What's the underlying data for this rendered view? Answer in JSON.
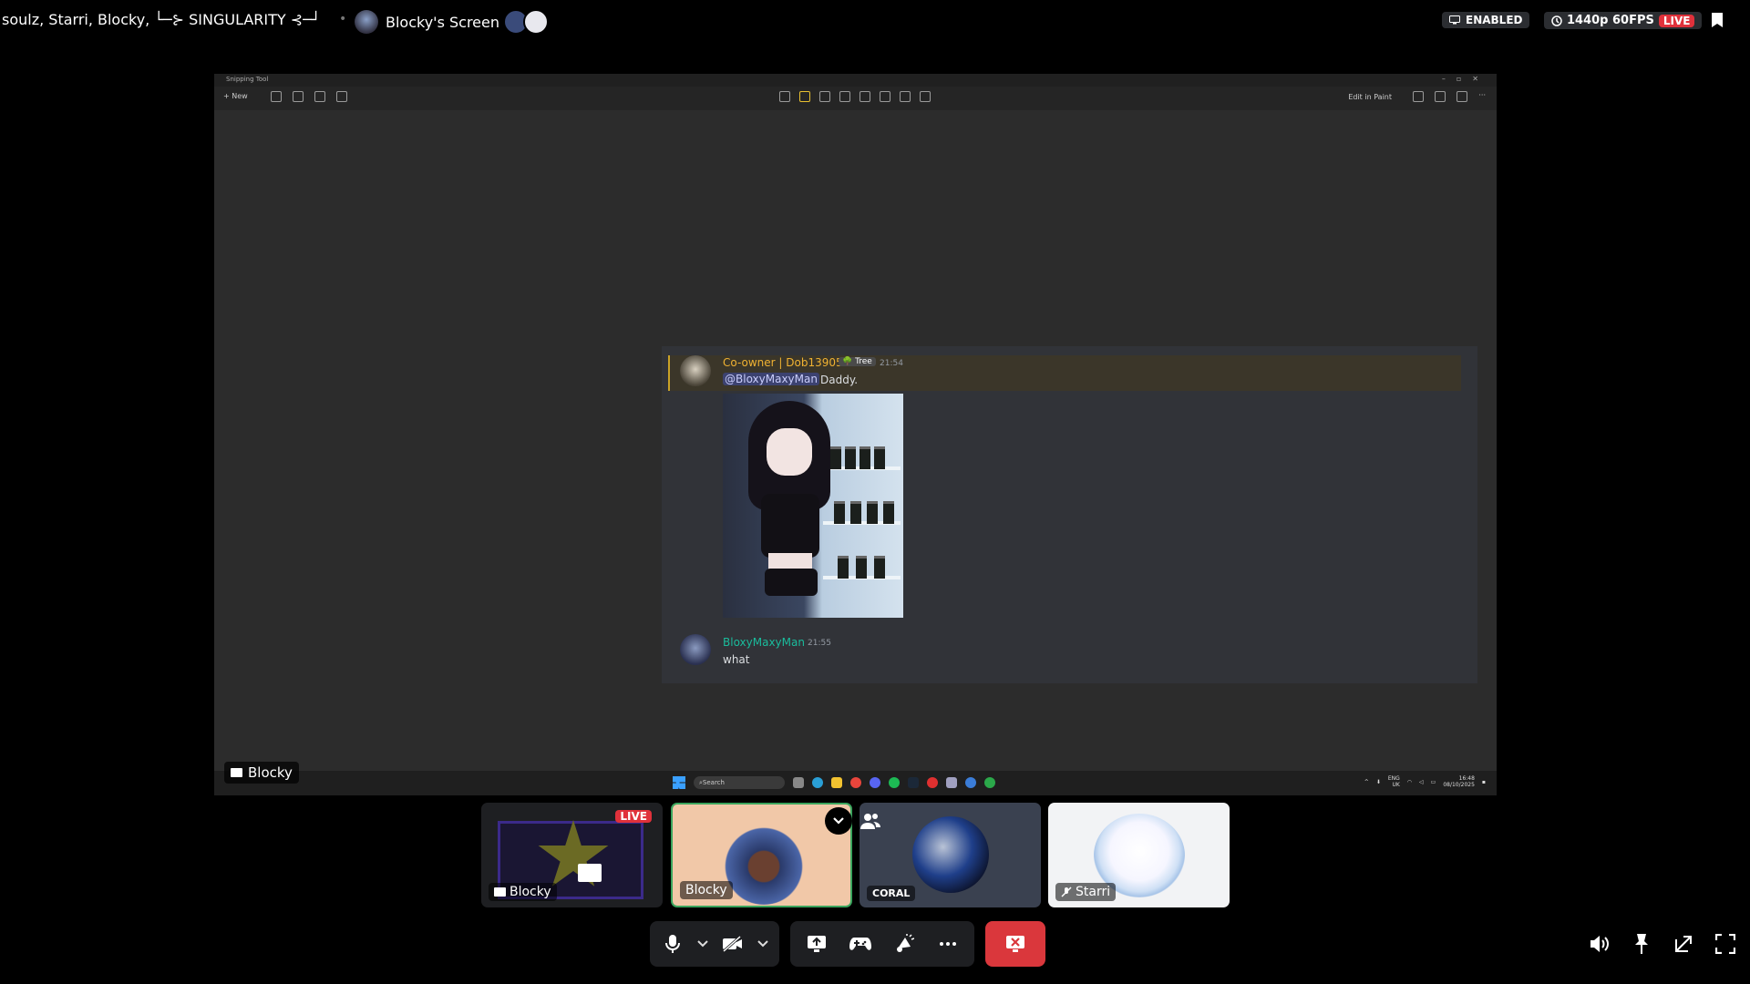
{
  "topbar": {
    "channel_text": "soulz, Starri, Blocky, └─⊱ SINGULARITY ⊰─┘",
    "separator": "•",
    "screen_label": "Blocky's Screen",
    "enabled_badge": "ENABLED",
    "quality_badge": "1440p 60FPS",
    "live_badge": "LIVE"
  },
  "snipping_tool": {
    "title": "Snipping Tool",
    "new_label": "New",
    "edit_in_paint": "Edit in Paint"
  },
  "messages": [
    {
      "username": "Co-owner | Dob13905",
      "role_tag": "Tree",
      "time": "21:54",
      "mention": "@BloxyMaxyMan",
      "text": "Daddy."
    },
    {
      "username": "BloxyMaxyMan",
      "time": "21:55",
      "text": "what"
    }
  ],
  "taskbar": {
    "search_placeholder": "Search",
    "lang": "ENG",
    "region": "UK",
    "clock_time": "16:48",
    "clock_date": "08/10/2025"
  },
  "stream_name_tag": "Blocky",
  "tiles": [
    {
      "label": "Blocky",
      "live": "LIVE",
      "kind": "stream"
    },
    {
      "label": "Blocky",
      "kind": "avatar"
    },
    {
      "label": "CORAL",
      "kind": "avatar"
    },
    {
      "label": "Starri",
      "kind": "avatar-muted"
    }
  ],
  "colors": {
    "live_red": "#e0313b",
    "end_call_red": "#da373c",
    "speaking_green": "#3aa55d",
    "owner_gold": "#f0b232",
    "bloxy_teal": "#1abc9c"
  },
  "icons": [
    "bookmark-icon",
    "screen-share-icon",
    "microphone-icon",
    "camera-off-icon",
    "game-controller-icon",
    "soundboard-icon",
    "more-icon",
    "end-call-icon",
    "volume-icon",
    "pin-icon",
    "pop-out-icon",
    "fullscreen-icon",
    "people-icon",
    "chevron-down-icon"
  ]
}
